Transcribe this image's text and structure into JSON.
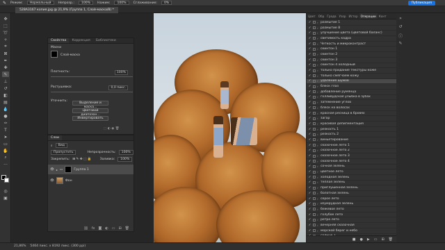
{
  "options_bar": {
    "mode_label": "Режим:",
    "mode_value": "Нормальный",
    "opacity_label": "Непрозр.:",
    "opacity_value": "100%",
    "flow_label": "Нажим:",
    "flow_value": "100%",
    "smoothing_label": "Сглаживание:",
    "smoothing_value": "0%",
    "publish_label": "Публикация"
  },
  "document_tab": {
    "title": "528A3167 копия.jpg @ 21,9% (Группа 1, Слой-маска/8) *"
  },
  "properties": {
    "tabs": [
      "Свойства",
      "Коррекция",
      "Библиотеки"
    ],
    "section_title": "Маски",
    "mask_label": "Слой-маска",
    "density_label": "Плотность:",
    "density_value": "100%",
    "feather_label": "Растушевка:",
    "feather_value": "0,0 пикс.",
    "refine_label": "Уточнить:",
    "buttons": [
      "Выделение и маска...",
      "Цветовой диапазон...",
      "Инвертировать"
    ]
  },
  "layers": {
    "tabs": [
      "Слои"
    ],
    "kind_label": "Вид",
    "blend_value": "Пропустить",
    "opacity_label": "Непрозрачность:",
    "opacity_value": "100%",
    "lock_label": "Закрепить:",
    "fill_label": "Заливка:",
    "fill_value": "100%",
    "items": [
      {
        "name": "Группа 1",
        "selected": true
      },
      {
        "name": "Фон",
        "selected": false
      }
    ]
  },
  "right_panel": {
    "tabs": [
      "Цвет",
      "Обр",
      "Града",
      "Узор",
      "Истор",
      "Операции",
      "Конт"
    ],
    "active_tab": "Операции",
    "actions": [
      "размытие 1",
      "размытие 8",
      "улучшение цвета (цветовой баланс)",
      "светимость кадра",
      "Четкость и микроконтраст",
      "скинтон 1",
      "скинтон 2",
      "скинтон 3",
      "скинтон 4 холодный",
      "только придание текстуры коже",
      "только смягчаем кожу",
      "удаление шумов",
      "блеск глаз",
      "добавление румянца",
      "голливудская улыбка в зубах",
      "затемнение углов",
      "блеск на волосах",
      "красная ресница в бровях",
      "загар",
      "красивая депигментация",
      "резкость 1",
      "резкость 2",
      "виньетирование",
      "сказочное лето 1",
      "сказочное лето 2",
      "сказочное лето 3",
      "сказочное лето 4",
      "сочная зелень",
      "цветное лето",
      "холодная зелень",
      "теплая зелень",
      "приглушенная зелень",
      "болотная зелень",
      "серое лето",
      "изумрудная зелень",
      "бежевое лето",
      "голубое лето",
      "ретро лето",
      "вечерняя сказочная",
      "морской берег и небо",
      "солнце 1",
      "солнце 2",
      "солнце 3"
    ],
    "selected_index": 11
  },
  "status_bar": {
    "zoom": "21,86%",
    "doc_info": "5464 пикс. x 8192 пикс. (300 ppi)"
  }
}
